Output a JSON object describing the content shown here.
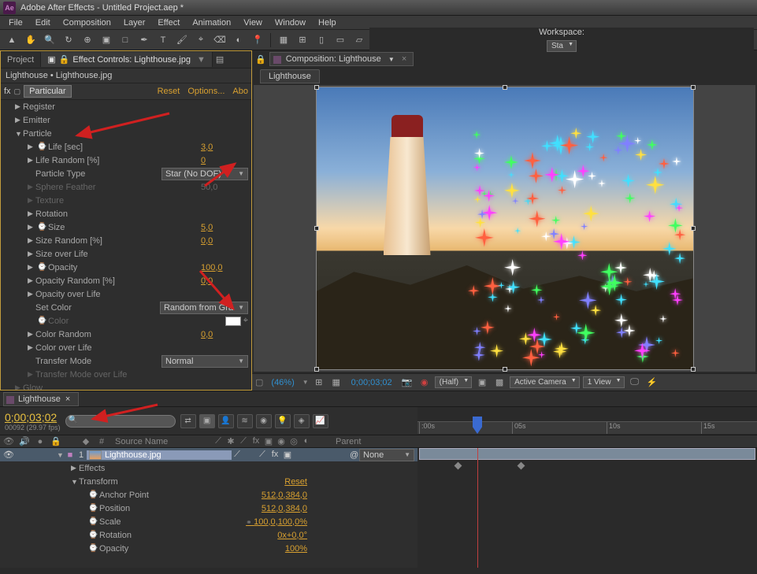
{
  "app": {
    "title": "Adobe After Effects - Untitled Project.aep *"
  },
  "menu": [
    "File",
    "Edit",
    "Composition",
    "Layer",
    "Effect",
    "Animation",
    "View",
    "Window",
    "Help"
  ],
  "workspace": {
    "label": "Workspace:",
    "value": "Sta"
  },
  "left_panel": {
    "tabs": {
      "project": "Project",
      "fx": "Effect Controls: Lighthouse.jpg"
    },
    "breadcrumb": "Lighthouse • Lighthouse.jpg",
    "fx_name": "Particular",
    "fx_reset": "Reset",
    "fx_options": "Options...",
    "fx_about": "Abo",
    "groups": {
      "register": "Register",
      "emitter": "Emitter",
      "particle": "Particle",
      "glow": "Glow"
    },
    "particle": {
      "life": {
        "label": "Life [sec]",
        "value": "3,0"
      },
      "life_random": {
        "label": "Life Random [%]",
        "value": "0"
      },
      "type": {
        "label": "Particle Type",
        "value": "Star (No DOF)"
      },
      "sphere_feather": {
        "label": "Sphere Feather",
        "value": "50,0"
      },
      "texture": {
        "label": "Texture"
      },
      "rotation": {
        "label": "Rotation"
      },
      "size": {
        "label": "Size",
        "value": "5,0"
      },
      "size_random": {
        "label": "Size Random [%]",
        "value": "0,0"
      },
      "size_over_life": {
        "label": "Size over Life"
      },
      "opacity": {
        "label": "Opacity",
        "value": "100,0"
      },
      "opacity_random": {
        "label": "Opacity Random [%]",
        "value": "0,0"
      },
      "opacity_over_life": {
        "label": "Opacity over Life"
      },
      "set_color": {
        "label": "Set Color",
        "value": "Random from Gra"
      },
      "color": {
        "label": "Color"
      },
      "color_random": {
        "label": "Color Random",
        "value": "0,0"
      },
      "color_over_life": {
        "label": "Color over Life"
      },
      "transfer_mode": {
        "label": "Transfer Mode",
        "value": "Normal"
      },
      "transfer_over_life": {
        "label": "Transfer Mode over Life"
      }
    }
  },
  "comp": {
    "tab": "Composition: Lighthouse",
    "subtab": "Lighthouse",
    "zoom": "(46%)",
    "time": "0;00;03;02",
    "res": "(Half)",
    "camera": "Active Camera",
    "views": "1 View"
  },
  "timeline": {
    "tab": "Lighthouse",
    "timecode": "0;00;03;02",
    "info": "00092 (29.97 fps)",
    "cols": {
      "source": "Source Name",
      "parent": "Parent"
    },
    "ruler": [
      ":00s",
      "05s",
      "10s",
      "15s"
    ],
    "layer": {
      "num": "1",
      "name": "Lighthouse.jpg",
      "parent": "None"
    },
    "effects": "Effects",
    "transform": {
      "label": "Transform",
      "reset": "Reset"
    },
    "props": {
      "anchor": {
        "label": "Anchor Point",
        "value": "512,0,384,0"
      },
      "position": {
        "label": "Position",
        "value": "512,0,384,0"
      },
      "scale": {
        "label": "Scale",
        "value": "100,0,100,0%"
      },
      "rotation": {
        "label": "Rotation",
        "value": "0x+0,0°"
      },
      "opacity": {
        "label": "Opacity",
        "value": "100%"
      }
    }
  }
}
